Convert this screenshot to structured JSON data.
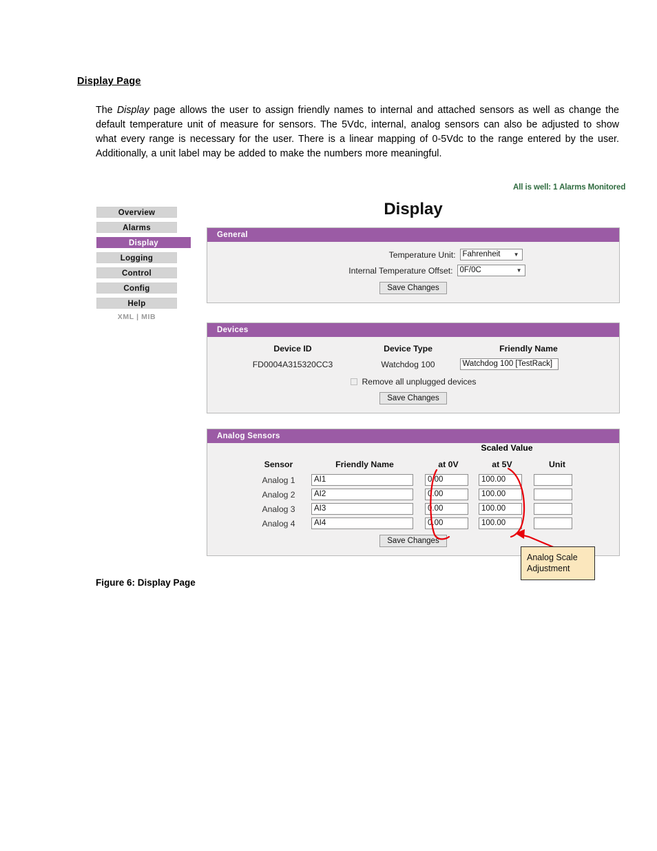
{
  "document": {
    "heading": "Display Page",
    "paragraph_prefix": "The ",
    "paragraph_italic": "Display",
    "paragraph_rest": " page allows the user to assign friendly names to internal and attached sensors as well as change the default temperature unit of measure for sensors.  The 5Vdc, internal, analog sensors can also be adjusted to show what every range is necessary for the user.  There is a linear mapping of 0-5Vdc to the range entered by the user.  Additionally, a unit label may be added to make the numbers more meaningful.",
    "figure_caption": "Figure 6: Display Page"
  },
  "screenshot": {
    "status": "All is well: 1 Alarms Monitored",
    "status_color": "#2f6b3f",
    "page_title": "Display",
    "accent_color": "#9b5ba5",
    "sidebar": {
      "items": [
        {
          "label": "Overview",
          "active": false
        },
        {
          "label": "Alarms",
          "active": false
        },
        {
          "label": "Display",
          "active": true
        },
        {
          "label": "Logging",
          "active": false
        },
        {
          "label": "Control",
          "active": false
        },
        {
          "label": "Config",
          "active": false
        },
        {
          "label": "Help",
          "active": false
        }
      ],
      "sub_links": "XML | MIB"
    },
    "general": {
      "title": "General",
      "temperature_unit_label": "Temperature Unit:",
      "temperature_unit_value": "Fahrenheit",
      "internal_offset_label": "Internal Temperature Offset:",
      "internal_offset_value": "0F/0C",
      "save_label": "Save Changes"
    },
    "devices": {
      "title": "Devices",
      "columns": [
        "Device ID",
        "Device Type",
        "Friendly Name"
      ],
      "rows": [
        {
          "device_id": "FD0004A315320CC3",
          "device_type": "Watchdog 100",
          "friendly_name": "Watchdog 100 [TestRack]"
        }
      ],
      "remove_unplugged_label": "Remove all unplugged devices",
      "remove_unplugged_checked": false,
      "save_label": "Save Changes"
    },
    "analog": {
      "title": "Analog Sensors",
      "scaled_value_header": "Scaled Value",
      "columns": [
        "Sensor",
        "Friendly Name",
        "at 0V",
        "at 5V",
        "Unit"
      ],
      "rows": [
        {
          "sensor": "Analog 1",
          "friendly_name": "AI1",
          "at_0v": "0.00",
          "at_5v": "100.00",
          "unit": ""
        },
        {
          "sensor": "Analog 2",
          "friendly_name": "AI2",
          "at_0v": "0.00",
          "at_5v": "100.00",
          "unit": ""
        },
        {
          "sensor": "Analog 3",
          "friendly_name": "AI3",
          "at_0v": "0.00",
          "at_5v": "100.00",
          "unit": ""
        },
        {
          "sensor": "Analog 4",
          "friendly_name": "AI4",
          "at_0v": "0.00",
          "at_5v": "100.00",
          "unit": ""
        }
      ],
      "save_label": "Save Changes"
    },
    "annotation": {
      "callout_line1": "Analog Scale",
      "callout_line2": "Adjustment",
      "color": "#e8000a",
      "fill": "#fbe7bd"
    }
  }
}
